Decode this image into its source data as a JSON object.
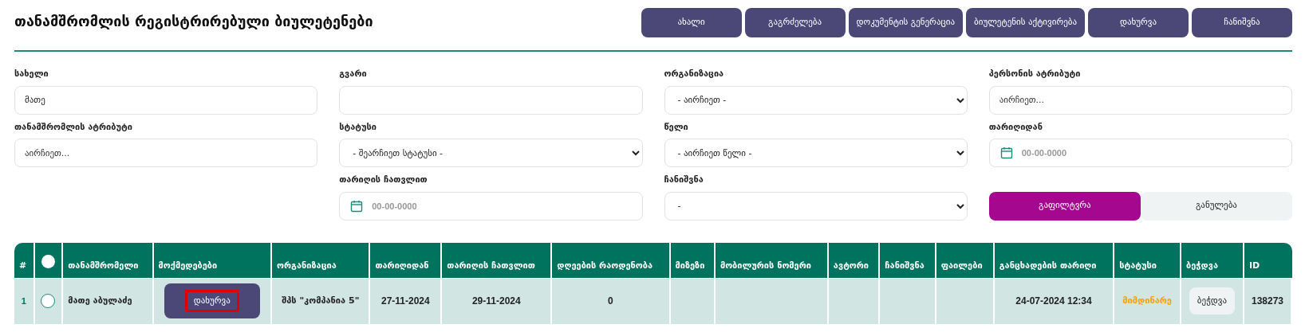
{
  "title": "თანამშრომლის რეგისტრირებული ბიულეტენები",
  "toolbar_buttons": [
    "ახალი",
    "გაგრძელება",
    "დოკუმენტის გენერაცია",
    "ბიულეტენის აქტივირება",
    "დახურვა",
    "ჩანიშვნა"
  ],
  "filters": [
    {
      "kind": "text",
      "label": "სახელი",
      "value": "მათე"
    },
    {
      "kind": "text",
      "label": "გვარი"
    },
    {
      "kind": "select",
      "label": "ორგანიზაცია",
      "value": "- აირჩიეთ -"
    },
    {
      "kind": "text",
      "label": "პერსონის ატრიბუტი",
      "placeholder": "აირჩიეთ..."
    },
    {
      "kind": "text",
      "label": "თანამშრომლის ატრიბუტი",
      "placeholder": "აირჩიეთ..."
    },
    {
      "kind": "select",
      "label": "სტატუსი",
      "value": "- შეარჩიეთ სტატუსი -"
    },
    {
      "kind": "select",
      "label": "წელი",
      "value": "- აირჩიეთ წელი -"
    },
    {
      "kind": "date",
      "label": "თარიღიდან",
      "placeholder": "00-00-0000"
    },
    {
      "kind": "date",
      "label": "თარიღის ჩათვლით",
      "placeholder": "00-00-0000"
    },
    {
      "kind": "select",
      "label": "ჩანიშვნა",
      "value": "-"
    }
  ],
  "filter_buttons": {
    "apply": "გაფილტვრა",
    "reset": "განულება"
  },
  "table": {
    "select_all": {
      "checked": false
    },
    "columns": [
      "#",
      "თანამშრომელი",
      "მოქმედებები",
      "ორგანიზაცია",
      "თარიღიდან",
      "თარიღის ჩათვლით",
      "დღეების რაოდენობა",
      "მიზეზი",
      "მობილურის ნომერი",
      "ავტორი",
      "ჩანიშვნა",
      "ფაილები",
      "განცხადების თარიღი",
      "სტატუსი",
      "ბეჭდვა",
      "ID"
    ],
    "rows": [
      {
        "number": "1",
        "selected": false,
        "employee": "მათე აბულაძე",
        "action": {
          "label": "დახურვა",
          "highlighted": true
        },
        "organization": "შპს \"კომპანია 5\"",
        "date_from": "27-11-2024",
        "date_to": "29-11-2024",
        "days": "0",
        "application_date": "24-07-2024 12:34",
        "status": {
          "text": "მიმდინარე",
          "color": "#f5a300"
        },
        "print": "ბეჭდვა",
        "id": "138273"
      }
    ]
  }
}
